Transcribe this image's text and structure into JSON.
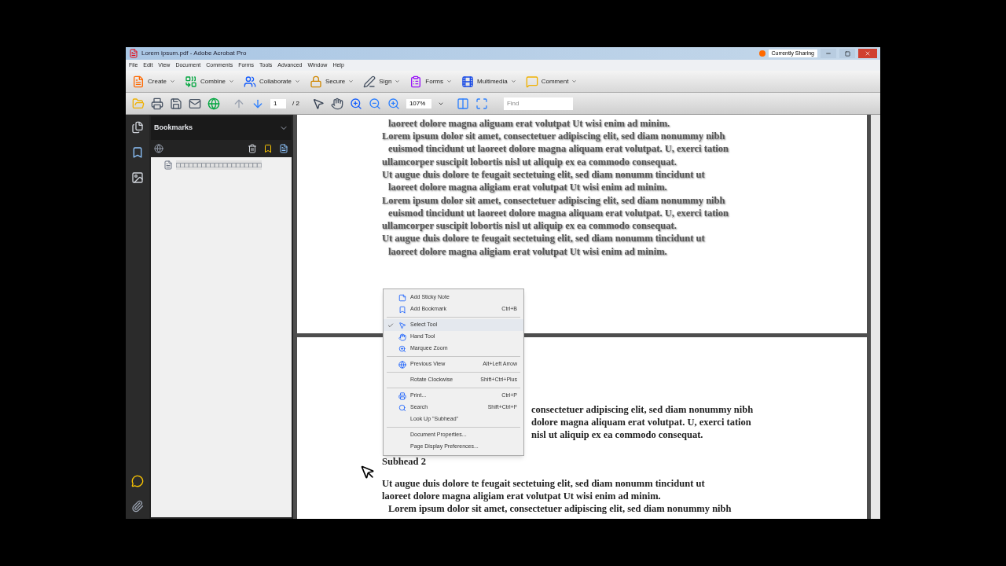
{
  "window": {
    "title": "Lorem ipsum.pdf - Adobe Acrobat Pro",
    "sharing_label": "Currently Sharing"
  },
  "menu_bar": [
    "File",
    "Edit",
    "View",
    "Document",
    "Comments",
    "Forms",
    "Tools",
    "Advanced",
    "Window",
    "Help"
  ],
  "task_toolbar": [
    "Create",
    "Combine",
    "Collaborate",
    "Secure",
    "Sign",
    "Forms",
    "Multimedia",
    "Comment"
  ],
  "nav_toolbar": {
    "page_number": "1",
    "page_count": "/ 2",
    "zoom": "107%",
    "find_placeholder": "Find"
  },
  "sidebar": {
    "panel_title": "Bookmarks",
    "bookmarks": [
      {
        "label": "□□□□□□□□□□□□□□□□□□□□"
      }
    ]
  },
  "document": {
    "page_1_lines": [
      "laoreet dolore magna aliguam erat volutpat Ut wisi enim ad minim.",
      "Lorem ipsum dolor sit amet, consectetuer adipiscing elit, sed diam nonummy nibh",
      "euismod tincidunt ut laoreet dolore magna aliquam erat volutpat. U, exerci tation",
      "ullamcorper suscipit lobortis nisl ut aliquip ex ea commodo consequat.",
      "Ut augue duis dolore te feugait sectetuing elit, sed diam nonumm tincidunt ut",
      "laoreet dolore magna aligiam erat volutpat Ut wisi enim ad minim.",
      "Lorem ipsum dolor sit amet, consectetuer adipiscing elit, sed diam nonummy nibh",
      "euismod tincidunt ut laoreet dolore magna aliquam erat volutpat. U, exerci tation",
      "ullamcorper suscipit lobortis nisl ut aliquip ex ea commodo consequat.",
      "Ut augue duis dolore te feugait sectetuing elit, sed diam nonumm tincidunt ut",
      "laoreet dolore magna aligiam erat volutpat Ut wisi enim ad minim."
    ],
    "page_2_lines": [
      "consectetuer adipiscing elit, sed diam nonummy nibh",
      "dolore magna aliquam erat volutpat. U, exerci tation",
      "nisl ut aliquip ex ea commodo consequat."
    ],
    "page_2_subhead": "Subhead 2",
    "page_2_after": [
      "Ut augue duis dolore te feugait sectetuing elit, sed diam nonumm tincidunt ut",
      "laoreet dolore magna aligiam erat volutpat Ut wisi enim ad minim.",
      "Lorem ipsum dolor sit amet, consectetuer adipiscing elit, sed diam nonummy nibh"
    ]
  },
  "context_menu": [
    {
      "kind": "item",
      "label": "Add Sticky Note",
      "checked": false
    },
    {
      "kind": "item",
      "label": "Add Bookmark",
      "shortcut": "Ctrl+B",
      "checked": false
    },
    {
      "kind": "separator"
    },
    {
      "kind": "item",
      "label": "Select Tool",
      "checked": true
    },
    {
      "kind": "item",
      "label": "Hand Tool",
      "checked": false
    },
    {
      "kind": "item",
      "label": "Marquee Zoom",
      "checked": false
    },
    {
      "kind": "separator"
    },
    {
      "kind": "item",
      "label": "Previous View",
      "shortcut": "Alt+Left Arrow",
      "checked": false
    },
    {
      "kind": "separator"
    },
    {
      "kind": "item",
      "label": "Rotate Clockwise",
      "shortcut": "Shift+Ctrl+Plus",
      "checked": false
    },
    {
      "kind": "separator"
    },
    {
      "kind": "item",
      "label": "Print...",
      "shortcut": "Ctrl+P",
      "checked": false
    },
    {
      "kind": "item",
      "label": "Search",
      "shortcut": "Shift+Ctrl+F",
      "checked": false
    },
    {
      "kind": "item",
      "label": "Look Up \"Subhead\"",
      "checked": false
    },
    {
      "kind": "separator"
    },
    {
      "kind": "item",
      "label": "Document Properties...",
      "checked": false
    },
    {
      "kind": "item",
      "label": "Page Display Preferences...",
      "checked": false
    }
  ]
}
